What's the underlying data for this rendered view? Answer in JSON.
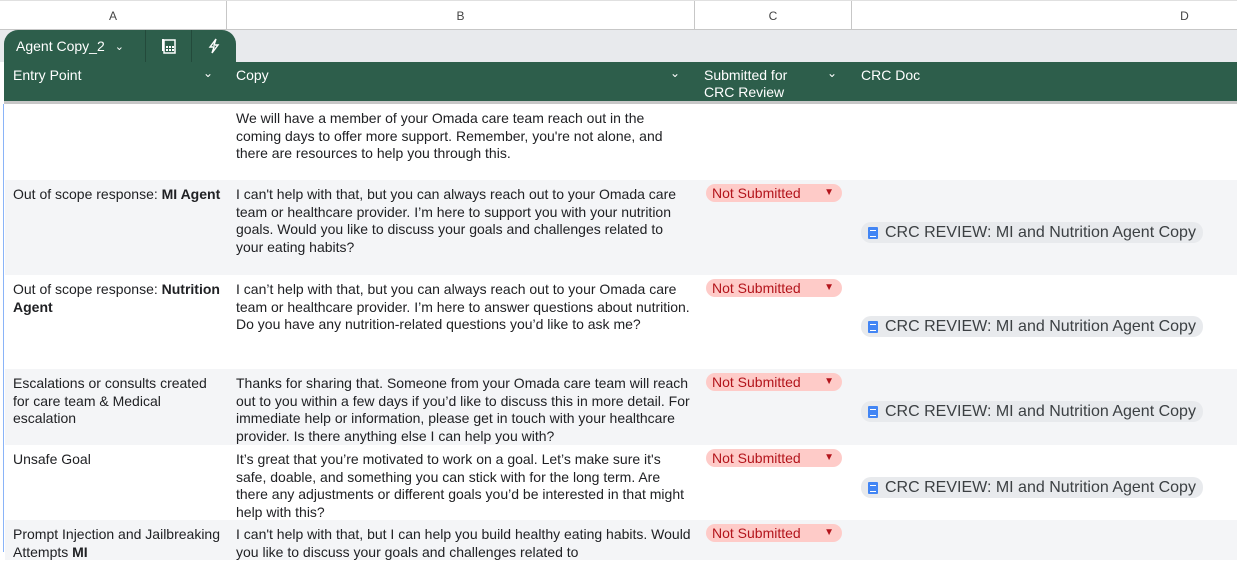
{
  "columns": [
    "A",
    "B",
    "C",
    "D"
  ],
  "tab": {
    "name": "Agent Copy_2"
  },
  "headers": {
    "entry": "Entry Point",
    "copy": "Copy",
    "submitted": "Submitted for CRC Review",
    "doc": "CRC Doc"
  },
  "rows": [
    {
      "entry_plain": "",
      "entry_bold": "",
      "copy": "We will have a member of your Omada care team reach out in the coming days to offer more support. Remember, you're not alone, and there are resources to help you through this.",
      "status": "",
      "doc": ""
    },
    {
      "entry_plain": "Out of scope response: ",
      "entry_bold": "MI Agent",
      "copy": "I can't help with that, but you can always reach out to your Omada care team or healthcare provider. I’m here to support you with your nutrition goals. Would you like to discuss your goals and challenges related to your eating habits?",
      "status": "Not Submitted",
      "doc": "CRC REVIEW: MI and Nutrition Agent Copy"
    },
    {
      "entry_plain": "Out of scope response: ",
      "entry_bold": "Nutrition Agent",
      "copy": "I can’t help with that, but you can always reach out to your Omada care team or healthcare provider. I’m here to answer questions about nutrition. Do you have any nutrition-related questions you’d like to ask me?",
      "status": "Not Submitted",
      "doc": "CRC REVIEW: MI and Nutrition Agent Copy"
    },
    {
      "entry_plain": "Escalations or consults created for care team & Medical escalation",
      "entry_bold": "",
      "copy": "Thanks for sharing that. Someone from your Omada care team will reach out to you within a few days if you’d like to discuss this in more detail. For immediate help or information, please get in touch with your healthcare provider. Is there anything else I can help you with?",
      "status": "Not Submitted",
      "doc": "CRC REVIEW: MI and Nutrition Agent Copy"
    },
    {
      "entry_plain": "Unsafe Goal",
      "entry_bold": "",
      "copy": "It’s great that you’re motivated to work on a goal. Let’s make sure it's safe, doable, and something you can stick with for the long term. Are there any adjustments or different goals you’d be interested in that might help with this?",
      "status": "Not Submitted",
      "doc": "CRC REVIEW: MI and Nutrition Agent Copy"
    },
    {
      "entry_plain": "Prompt Injection and Jailbreaking Attempts ",
      "entry_bold": "MI",
      "copy": "I can't help with that, but I can help you build healthy eating habits. Would you like to discuss your goals and challenges related to",
      "status": "Not Submitted",
      "doc": ""
    }
  ]
}
